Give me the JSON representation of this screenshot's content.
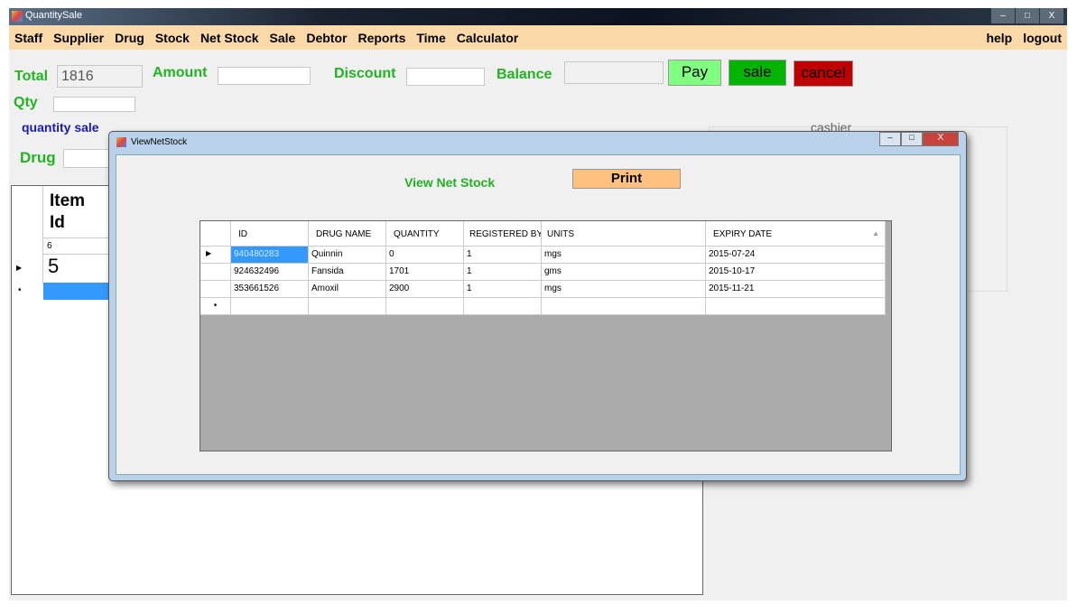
{
  "window": {
    "title": "QuantitySale",
    "controls": [
      "–",
      "□",
      "X"
    ]
  },
  "menu": {
    "items": [
      "Staff",
      "Supplier",
      "Drug",
      "Stock",
      "Net Stock",
      "Sale",
      "Debtor",
      "Reports",
      "Time",
      "Calculator"
    ],
    "right": [
      "help",
      "logout"
    ]
  },
  "form": {
    "total_label": "Total",
    "total_value": "1816",
    "amount_label": "Amount",
    "amount_value": "",
    "discount_label": "Discount",
    "discount_value": "",
    "balance_label": "Balance",
    "balance_value": "",
    "qty_label": "Qty",
    "qty_value": "",
    "pay": "Pay",
    "sale": "sale",
    "cancel": "cancel",
    "group_label": "quantity sale",
    "drug_label": "Drug",
    "drug_value": "",
    "cashier_label": "cashier"
  },
  "left_grid": {
    "header": "Item Id",
    "rows": [
      "6",
      "5"
    ]
  },
  "dialog": {
    "title": "ViewNetStock",
    "heading": "View Net Stock",
    "print": "Print",
    "columns": [
      "ID",
      "DRUG NAME",
      "QUANTITY",
      "REGISTERED BY",
      "UNITS",
      "EXPIRY DATE"
    ],
    "rows": [
      [
        "940480283",
        "Quinnin",
        "0",
        "1",
        "mgs",
        "2015-07-24"
      ],
      [
        "924632496",
        "Fansida",
        "1701",
        "1",
        "gms",
        "2015-10-17"
      ],
      [
        "353661526",
        "Amoxil",
        "2900",
        "1",
        "mgs",
        "2015-11-21"
      ]
    ]
  },
  "colors": {
    "menu": "#fbd9a8",
    "label_green": "#22b322",
    "pay": "#80ff80",
    "sale": "#00b400",
    "cancel": "#c00000",
    "print": "#ffc080",
    "selection": "#3399ff"
  }
}
